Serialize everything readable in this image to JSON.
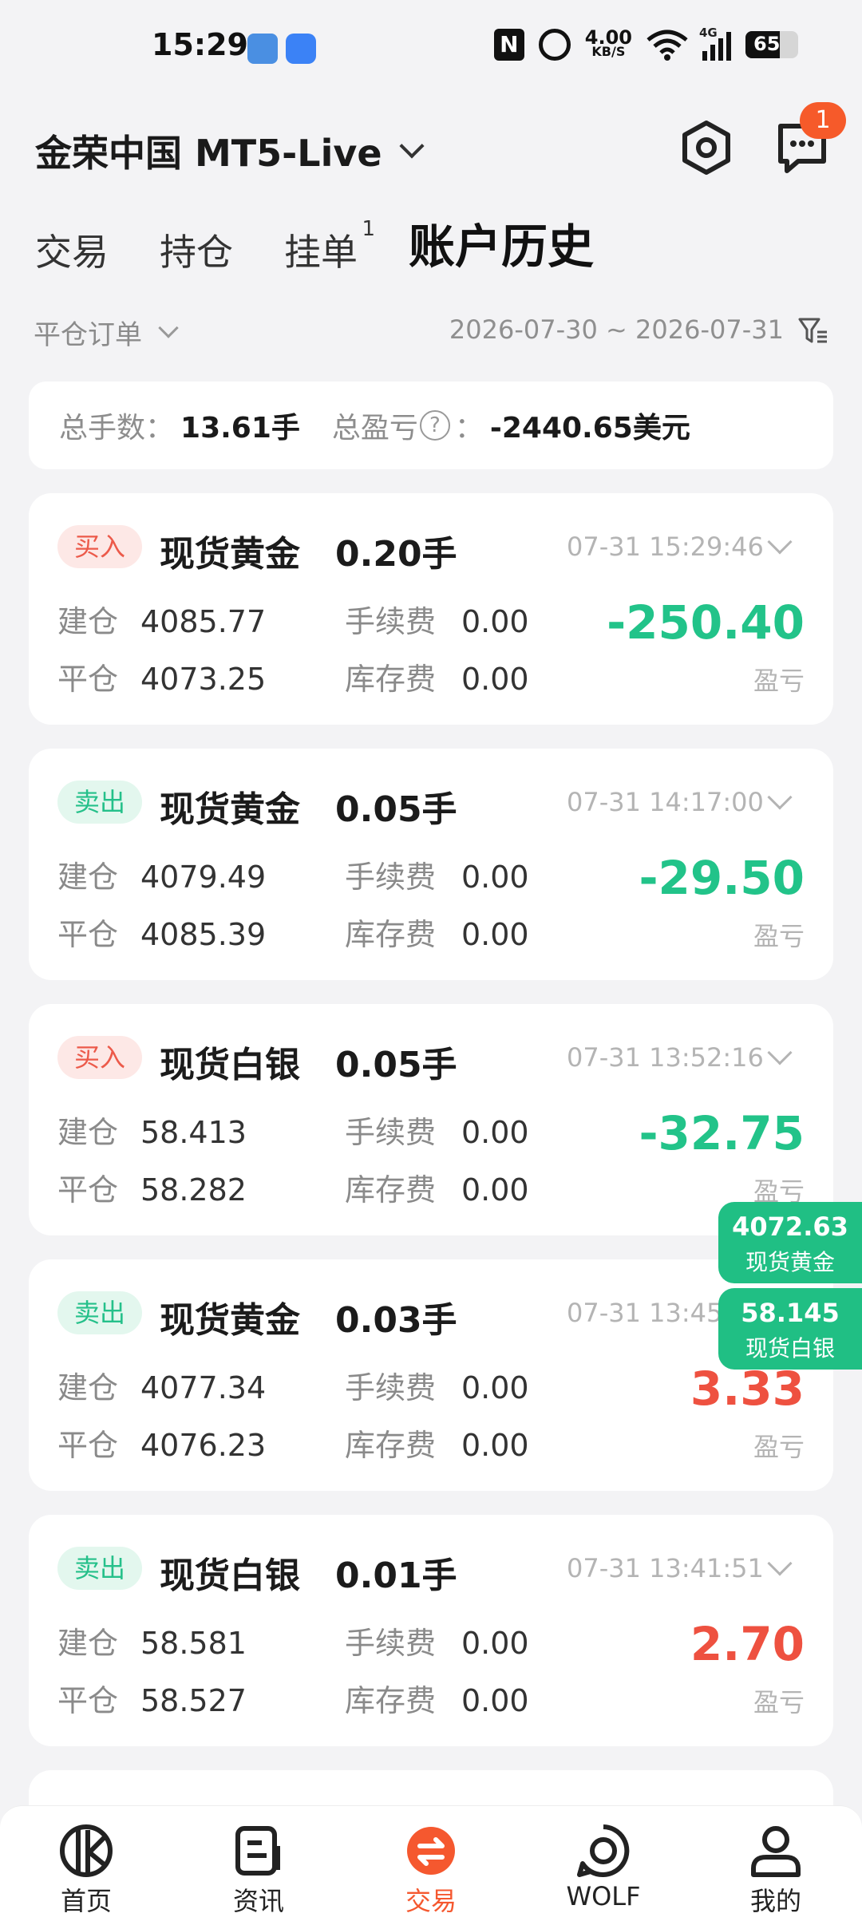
{
  "status_bar": {
    "time": "15:29",
    "net_speed_value": "4.00",
    "net_speed_unit": "KB/S",
    "network": "4G",
    "battery": "65"
  },
  "header": {
    "title": "金荣中国 MT5-Live",
    "message_badge": "1"
  },
  "tabs": [
    {
      "label": "交易"
    },
    {
      "label": "持仓"
    },
    {
      "label": "挂单",
      "badge": "1"
    },
    {
      "label": "账户历史",
      "active": true
    }
  ],
  "filter": {
    "type_label": "平仓订单",
    "date_range": "2026-07-30 ~ 2026-07-31"
  },
  "summary": {
    "total_lots_label": "总手数：",
    "total_lots_value": "13.61手",
    "total_pnl_label": "总盈亏",
    "total_pnl_colon": "：",
    "total_pnl_value": "-2440.65美元"
  },
  "orders": [
    {
      "side": "买入",
      "side_type": "buy",
      "name": "现货黄金",
      "lots": "0.20手",
      "time": "07-31 15:29:46",
      "open_label": "建仓",
      "open": "4085.77",
      "close_label": "平仓",
      "close": "4073.25",
      "fee_label": "手续费",
      "fee": "0.00",
      "swap_label": "库存费",
      "swap": "0.00",
      "pnl": "-250.40",
      "pnl_label": "盈亏"
    },
    {
      "side": "卖出",
      "side_type": "sell",
      "name": "现货黄金",
      "lots": "0.05手",
      "time": "07-31 14:17:00",
      "open_label": "建仓",
      "open": "4079.49",
      "close_label": "平仓",
      "close": "4085.39",
      "fee_label": "手续费",
      "fee": "0.00",
      "swap_label": "库存费",
      "swap": "0.00",
      "pnl": "-29.50",
      "pnl_label": "盈亏"
    },
    {
      "side": "买入",
      "side_type": "buy",
      "name": "现货白银",
      "lots": "0.05手",
      "time": "07-31 13:52:16",
      "open_label": "建仓",
      "open": "58.413",
      "close_label": "平仓",
      "close": "58.282",
      "fee_label": "手续费",
      "fee": "0.00",
      "swap_label": "库存费",
      "swap": "0.00",
      "pnl": "-32.75",
      "pnl_label": "盈亏"
    },
    {
      "side": "卖出",
      "side_type": "sell",
      "name": "现货黄金",
      "lots": "0.03手",
      "time": "07-31 13:45",
      "open_label": "建仓",
      "open": "4077.34",
      "close_label": "平仓",
      "close": "4076.23",
      "fee_label": "手续费",
      "fee": "0.00",
      "swap_label": "库存费",
      "swap": "0.00",
      "pnl": "3.33",
      "pnl_label": "盈亏"
    },
    {
      "side": "卖出",
      "side_type": "sell",
      "name": "现货白银",
      "lots": "0.01手",
      "time": "07-31 13:41:51",
      "open_label": "建仓",
      "open": "58.581",
      "close_label": "平仓",
      "close": "58.527",
      "fee_label": "手续费",
      "fee": "0.00",
      "swap_label": "库存费",
      "swap": "0.00",
      "pnl": "2.70",
      "pnl_label": "盈亏"
    }
  ],
  "quotes": [
    {
      "price": "4072.63",
      "name": "现货黄金"
    },
    {
      "price": "58.145",
      "name": "现货白银"
    }
  ],
  "bottom_nav": [
    {
      "label": "首页",
      "icon": "home-logo-icon"
    },
    {
      "label": "资讯",
      "icon": "news-icon"
    },
    {
      "label": "交易",
      "icon": "trade-icon",
      "active": true
    },
    {
      "label": "WOLF",
      "icon": "wolf-icon"
    },
    {
      "label": "我的",
      "icon": "profile-icon"
    }
  ],
  "colors": {
    "accent": "#f5582f",
    "profit": "#ee5140",
    "loss": "#22c389",
    "quote_bg": "#20bf84"
  }
}
